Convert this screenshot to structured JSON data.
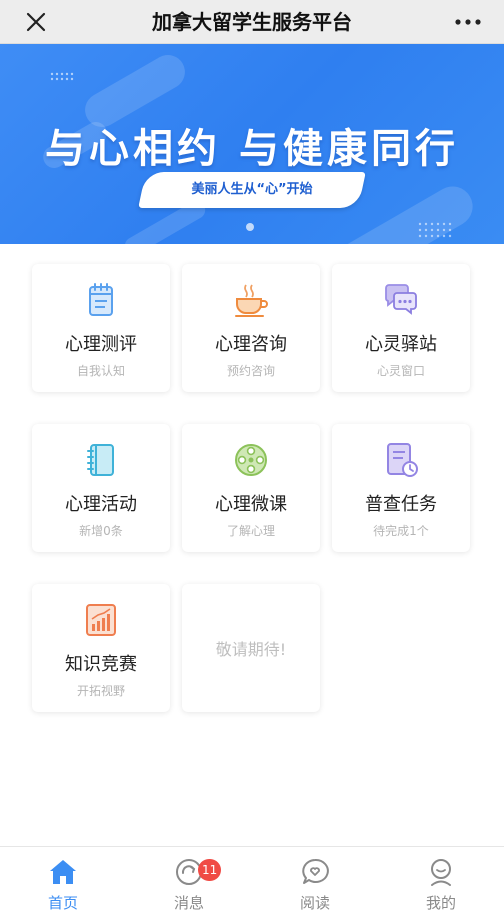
{
  "header": {
    "title": "加拿大留学生服务平台",
    "close_icon": "close-icon",
    "more_icon": "more-dots-icon"
  },
  "banner": {
    "headline": "与心相约 与健康同行",
    "tagline": "美丽人生从“心”开始"
  },
  "colors": {
    "primary": "#3c8ef3",
    "badge": "#f04b45",
    "muted_text": "#b5b5b5"
  },
  "grid": [
    {
      "label": "心理测评",
      "sub": "自我认知",
      "icon": "notebook-icon"
    },
    {
      "label": "心理咨询",
      "sub": "预约咨询",
      "icon": "coffee-cup-icon"
    },
    {
      "label": "心灵驿站",
      "sub": "心灵窗口",
      "icon": "chat-bubbles-icon"
    },
    {
      "label": "心理活动",
      "sub": "新增0条",
      "icon": "activity-book-icon"
    },
    {
      "label": "心理微课",
      "sub": "了解心理",
      "icon": "film-reel-icon"
    },
    {
      "label": "普查任务",
      "sub": "待完成1个",
      "icon": "task-clock-icon"
    },
    {
      "label": "知识竞赛",
      "sub": "开拓视野",
      "icon": "bar-chart-icon"
    }
  ],
  "placeholder": "敬请期待!",
  "bottom_nav": [
    {
      "label": "首页",
      "icon": "home-icon",
      "active": true
    },
    {
      "label": "消息",
      "icon": "message-icon",
      "badge": "11"
    },
    {
      "label": "阅读",
      "icon": "read-icon"
    },
    {
      "label": "我的",
      "icon": "profile-icon"
    }
  ]
}
